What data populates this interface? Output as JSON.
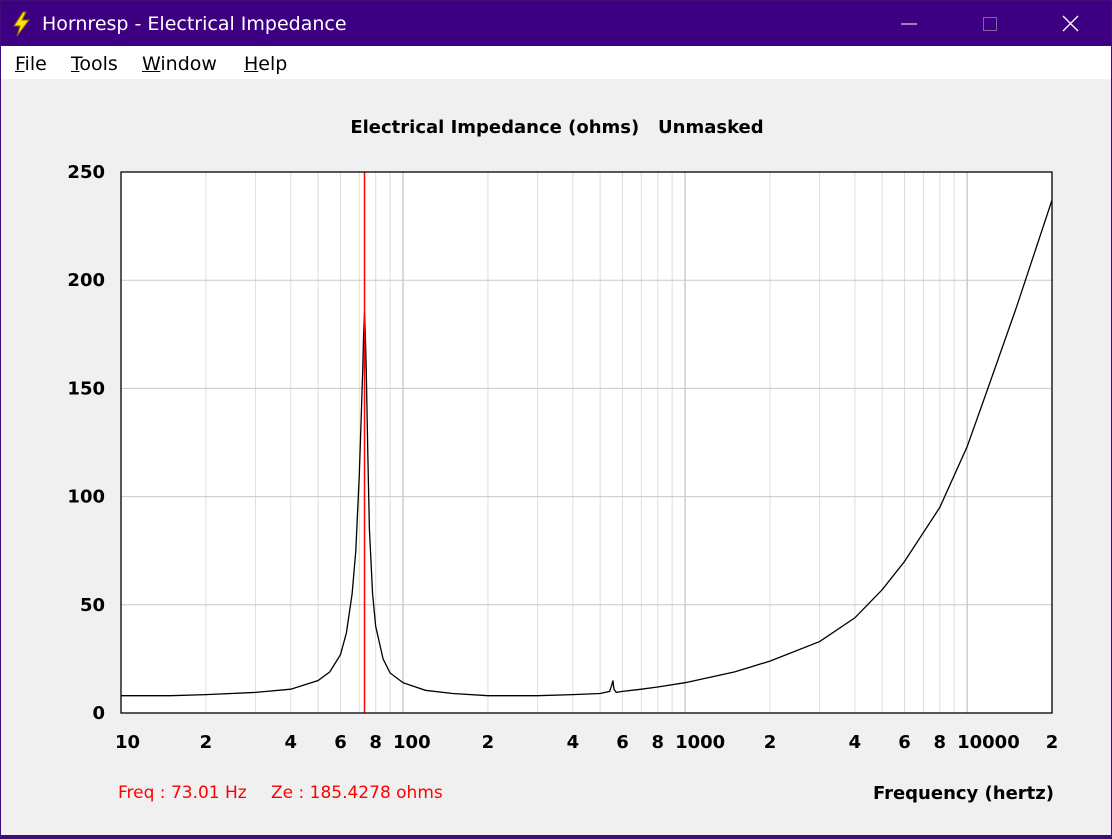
{
  "window": {
    "title": "Hornresp - Electrical Impedance"
  },
  "menu": {
    "items": [
      {
        "label": "File",
        "accel": "F",
        "rest": "ile"
      },
      {
        "label": "Tools",
        "accel": "T",
        "rest": "ools"
      },
      {
        "label": "Window",
        "accel": "W",
        "rest": "indow"
      },
      {
        "label": "Help",
        "accel": "H",
        "rest": "elp"
      }
    ]
  },
  "readout": {
    "freq": "Freq : 73.01 Hz",
    "ze": "Ze : 185.4278 ohms"
  },
  "colors": {
    "titlebar": "#3d0083",
    "curve": "#000000",
    "cursor": "#ff0000",
    "grid": "#c8c8c8",
    "plot_bg": "#ffffff"
  },
  "chart_data": {
    "type": "line",
    "title": "Electrical Impedance (ohms)   Unmasked",
    "xlabel": "Frequency (hertz)",
    "ylabel": "",
    "x_scale": "log",
    "xlim": [
      10,
      20000
    ],
    "ylim": [
      0,
      250
    ],
    "grid": true,
    "y_ticks": [
      "0",
      "50",
      "100",
      "150",
      "200",
      "250"
    ],
    "x_ticks": [
      {
        "value": 10,
        "label": "10"
      },
      {
        "value": 20,
        "label": "2"
      },
      {
        "value": 40,
        "label": "4"
      },
      {
        "value": 60,
        "label": "6"
      },
      {
        "value": 80,
        "label": "8"
      },
      {
        "value": 100,
        "label": "100"
      },
      {
        "value": 200,
        "label": "2"
      },
      {
        "value": 400,
        "label": "4"
      },
      {
        "value": 600,
        "label": "6"
      },
      {
        "value": 800,
        "label": "8"
      },
      {
        "value": 1000,
        "label": "1000"
      },
      {
        "value": 2000,
        "label": "2"
      },
      {
        "value": 4000,
        "label": "4"
      },
      {
        "value": 6000,
        "label": "6"
      },
      {
        "value": 8000,
        "label": "8"
      },
      {
        "value": 10000,
        "label": "10000"
      },
      {
        "value": 20000,
        "label": "2"
      }
    ],
    "cursor_x": 73.01,
    "series": [
      {
        "x": [
          10,
          15,
          20,
          30,
          40,
          50,
          55,
          60,
          63,
          66,
          68,
          70,
          71,
          72,
          72.5,
          73,
          73.5,
          74,
          75,
          76,
          78,
          80,
          85,
          90,
          100,
          120,
          150,
          200,
          300,
          400,
          500,
          540,
          550,
          555,
          560,
          570,
          600,
          700,
          800,
          1000,
          1500,
          2000,
          3000,
          4000,
          5000,
          6000,
          8000,
          10000,
          12000,
          15000,
          20000
        ],
        "y": [
          8,
          8,
          8.5,
          9.5,
          11,
          15,
          19,
          27,
          37,
          55,
          75,
          110,
          135,
          160,
          175,
          185,
          175,
          160,
          120,
          85,
          55,
          40,
          25,
          18.5,
          14,
          10.5,
          9,
          8,
          8,
          8.5,
          9,
          10,
          13,
          15,
          11,
          9.5,
          10,
          11,
          12,
          14,
          19,
          24,
          33,
          44,
          57,
          70,
          95,
          123,
          152,
          188,
          237
        ]
      }
    ]
  }
}
